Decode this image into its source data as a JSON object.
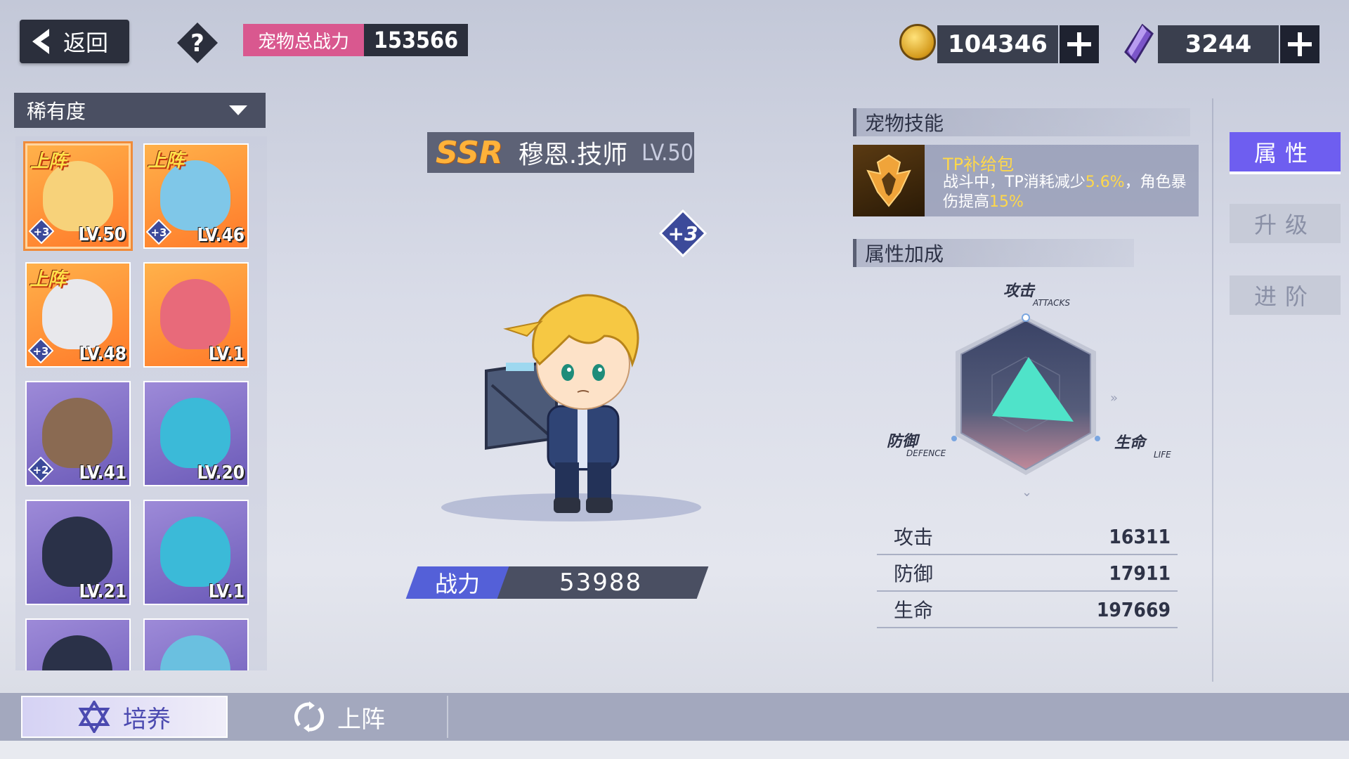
{
  "header": {
    "back_label": "返回",
    "help_label": "?",
    "total_power_label": "宠物总战力",
    "total_power_value": "153566",
    "gold": "104346",
    "gems": "3244"
  },
  "sidebar": {
    "filter_label": "稀有度",
    "deploy_tag": "上阵",
    "pets": [
      {
        "level": "LV.50",
        "deployed": true,
        "plus": "+3",
        "color": "orange"
      },
      {
        "level": "LV.46",
        "deployed": true,
        "plus": "+3",
        "color": "orange"
      },
      {
        "level": "LV.48",
        "deployed": true,
        "plus": "+3",
        "color": "orange"
      },
      {
        "level": "LV.1",
        "deployed": false,
        "plus": "",
        "color": "orange"
      },
      {
        "level": "LV.41",
        "deployed": false,
        "plus": "+2",
        "color": "purple"
      },
      {
        "level": "LV.20",
        "deployed": false,
        "plus": "",
        "color": "purple"
      },
      {
        "level": "LV.21",
        "deployed": false,
        "plus": "",
        "color": "purple"
      },
      {
        "level": "LV.1",
        "deployed": false,
        "plus": "",
        "color": "purple"
      },
      {
        "level": "",
        "deployed": false,
        "plus": "",
        "color": "purple"
      },
      {
        "level": "",
        "deployed": false,
        "plus": "",
        "color": "purple"
      }
    ]
  },
  "pet": {
    "rarity": "SSR",
    "name": "穆恩.技师",
    "level": "LV.50",
    "plus": "+3",
    "combat_label": "战力",
    "combat_value": "53988"
  },
  "skill": {
    "section_title": "宠物技能",
    "name": "TP补给包",
    "desc_1": "战斗中，TP消耗减少",
    "val_1": "5.6%",
    "desc_2": "，角色暴伤提高",
    "val_2": "15%"
  },
  "attributes": {
    "section_title": "属性加成",
    "axis_attack": "攻击",
    "axis_attack_en": "ATTACKS",
    "axis_defence": "防御",
    "axis_defence_en": "DEFENCE",
    "axis_life": "生命",
    "axis_life_en": "LIFE",
    "stats": [
      {
        "label": "攻击",
        "value": "16311"
      },
      {
        "label": "防御",
        "value": "17911"
      },
      {
        "label": "生命",
        "value": "197669"
      }
    ]
  },
  "tabs": {
    "attributes": "属性",
    "upgrade": "升级",
    "advance": "进阶"
  },
  "bottom_tabs": {
    "train": "培养",
    "deploy": "上阵"
  },
  "colors": {
    "accent": "#6e5ef0",
    "power_label_bg": "#d9588f",
    "radar_fill": "#4fe3c9",
    "skill_highlight": "#ffd84a"
  }
}
